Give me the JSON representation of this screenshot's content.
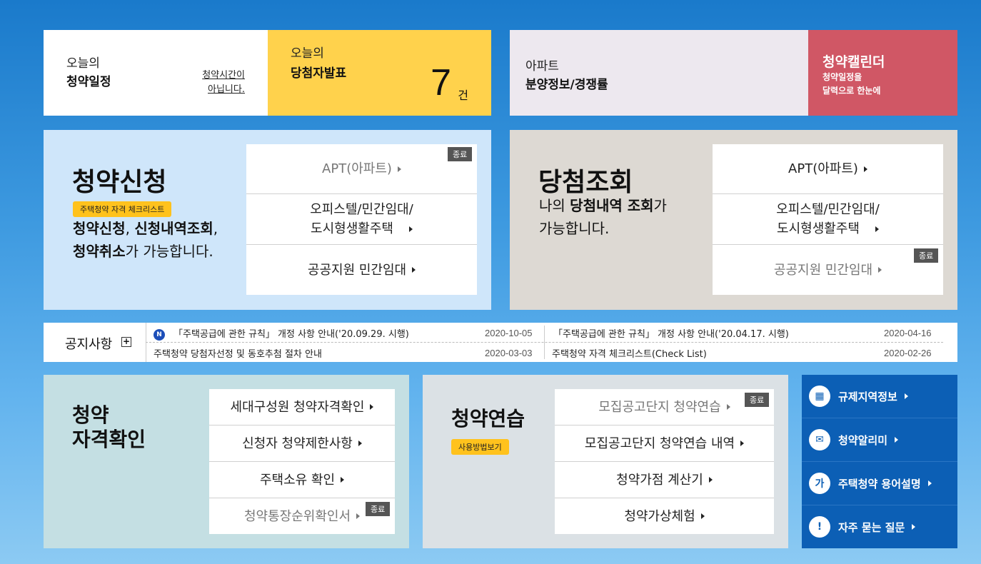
{
  "today_schedule": {
    "line1": "오늘의",
    "line2": "청약일정",
    "link_line1": "청약시간이",
    "link_line2": "아닙니다."
  },
  "today_winner": {
    "line1": "오늘의",
    "line2": "당첨자발표",
    "count": "7",
    "unit": "건"
  },
  "apt_info": {
    "line1": "아파트",
    "line2": "분양정보/경쟁률"
  },
  "calendar": {
    "title": "청약캘린더",
    "sub1": "청약일정을",
    "sub2": "달력으로 한눈에"
  },
  "apply": {
    "title": "청약신청",
    "tag": "주택청약 자격 체크리스트",
    "desc1_b1": "청약신청",
    "desc1_t1": ", ",
    "desc1_b2": "신청내역조회",
    "desc1_t2": ",",
    "desc2_b": "청약취소",
    "desc2_t": "가 가능합니다.",
    "end_badge": "종료",
    "menu": [
      {
        "label": "APT(아파트)"
      },
      {
        "label1": "오피스텔/민간임대/",
        "label2": "도시형생활주택"
      },
      {
        "label": "공공지원 민간임대"
      }
    ]
  },
  "result": {
    "title": "당첨조회",
    "desc1_t": "나의 ",
    "desc1_b": "당첨내역 조회",
    "desc1_t2": "가",
    "desc2": "가능합니다.",
    "end_badge": "종료",
    "menu": [
      {
        "label": "APT(아파트)"
      },
      {
        "label1": "오피스텔/민간임대/",
        "label2": "도시형생활주택"
      },
      {
        "label": "공공지원 민간임대"
      }
    ]
  },
  "notice": {
    "label": "공지사항",
    "plus": "+",
    "new_badge": "N",
    "items": [
      {
        "title": "「주택공급에 관한 규칙」 개정 사항 안내('20.09.29. 시행)",
        "date": "2020-10-05"
      },
      {
        "title": "「주택공급에 관한 규칙」 개정 사항 안내('20.04.17. 시행)",
        "date": "2020-04-16"
      },
      {
        "title": "주택청약 당첨자선정 및 동호추첨 절차 안내",
        "date": "2020-03-03"
      },
      {
        "title": "주택청약 자격 체크리스트(Check List)",
        "date": "2020-02-26"
      }
    ]
  },
  "qualification": {
    "title1": "청약",
    "title2": "자격확인",
    "end_badge": "종료",
    "menu": [
      "세대구성원 청약자격확인",
      "신청자 청약제한사항",
      "주택소유 확인",
      "청약통장순위확인서"
    ]
  },
  "practice": {
    "title": "청약연습",
    "tag": "사용방법보기",
    "end_badge": "종료",
    "menu": [
      "모집공고단지 청약연습",
      "모집공고단지 청약연습 내역",
      "청약가점 계산기",
      "청약가상체험"
    ]
  },
  "side": {
    "items": [
      {
        "icon": "building-icon",
        "glyph": "▦",
        "label": "규제지역정보"
      },
      {
        "icon": "mail-icon",
        "glyph": "✉",
        "label": "청약알리미"
      },
      {
        "icon": "glossary-icon",
        "glyph": "가",
        "label": "주택청약 용어설명"
      },
      {
        "icon": "exclamation-icon",
        "glyph": "!",
        "label": "자주 묻는 질문"
      }
    ]
  }
}
